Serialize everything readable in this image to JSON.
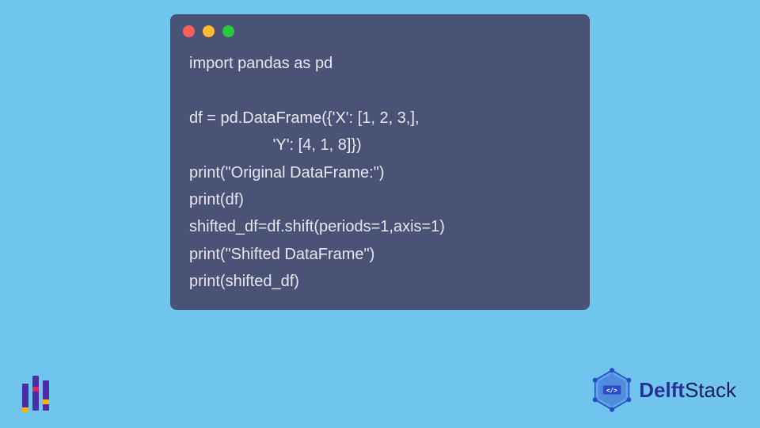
{
  "code": {
    "line1": "import pandas as pd",
    "line2": "",
    "line3": "df = pd.DataFrame({'X': [1, 2, 3,],",
    "line4": "                   'Y': [4, 1, 8]})",
    "line5": "print(\"Original DataFrame:\")",
    "line6": "print(df)",
    "line7": "shifted_df=df.shift(periods=1,axis=1)",
    "line8": "print(\"Shifted DataFrame\")",
    "line9": "print(shifted_df)"
  },
  "brand": {
    "name_prefix": "Delft",
    "name_suffix": "Stack"
  },
  "colors": {
    "bg": "#6fc5ed",
    "window": "#4a5275",
    "brand": "#2a3093"
  }
}
